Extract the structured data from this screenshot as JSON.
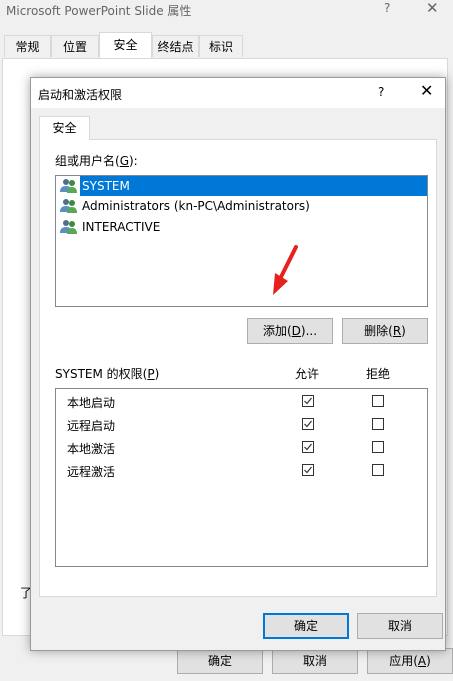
{
  "background_dialog": {
    "title": "Microsoft PowerPoint Slide 属性",
    "help": "?",
    "close": "✕",
    "tabs": [
      "常规",
      "位置",
      "安全",
      "终结点",
      "标识"
    ],
    "partial_text": "了",
    "buttons": {
      "ok": "确定",
      "cancel": "取消",
      "apply_prefix": "应用(",
      "apply_key": "A",
      "apply_suffix": ")"
    }
  },
  "dialog": {
    "title": "启动和激活权限",
    "help": "?",
    "close": "✕",
    "tab": "安全",
    "group_label_prefix": "组或用户名(",
    "group_label_key": "G",
    "group_label_suffix": "):",
    "users": [
      {
        "name": "SYSTEM",
        "selected": true
      },
      {
        "name": "Administrators (kn-PC\\Administrators)",
        "selected": false
      },
      {
        "name": "INTERACTIVE",
        "selected": false
      }
    ],
    "add_button": {
      "prefix": "添加(",
      "key": "D",
      "suffix": ")..."
    },
    "remove_button": {
      "prefix": "删除(",
      "key": "R",
      "suffix": ")"
    },
    "perm_label_prefix": "SYSTEM 的权限(",
    "perm_label_key": "P",
    "perm_label_suffix": ")",
    "allow_header": "允许",
    "deny_header": "拒绝",
    "permissions": [
      {
        "name": "本地启动",
        "allow": true,
        "deny": false
      },
      {
        "name": "远程启动",
        "allow": true,
        "deny": false
      },
      {
        "name": "本地激活",
        "allow": true,
        "deny": false
      },
      {
        "name": "远程激活",
        "allow": true,
        "deny": false
      }
    ],
    "ok_button": "确定",
    "cancel_button": "取消"
  },
  "colors": {
    "selection": "#0078d7",
    "arrow": "#e8201c",
    "user_icon": "#5a8fc2"
  },
  "icons": {
    "user": "users-icon",
    "arrow": "red-pointer-arrow"
  }
}
